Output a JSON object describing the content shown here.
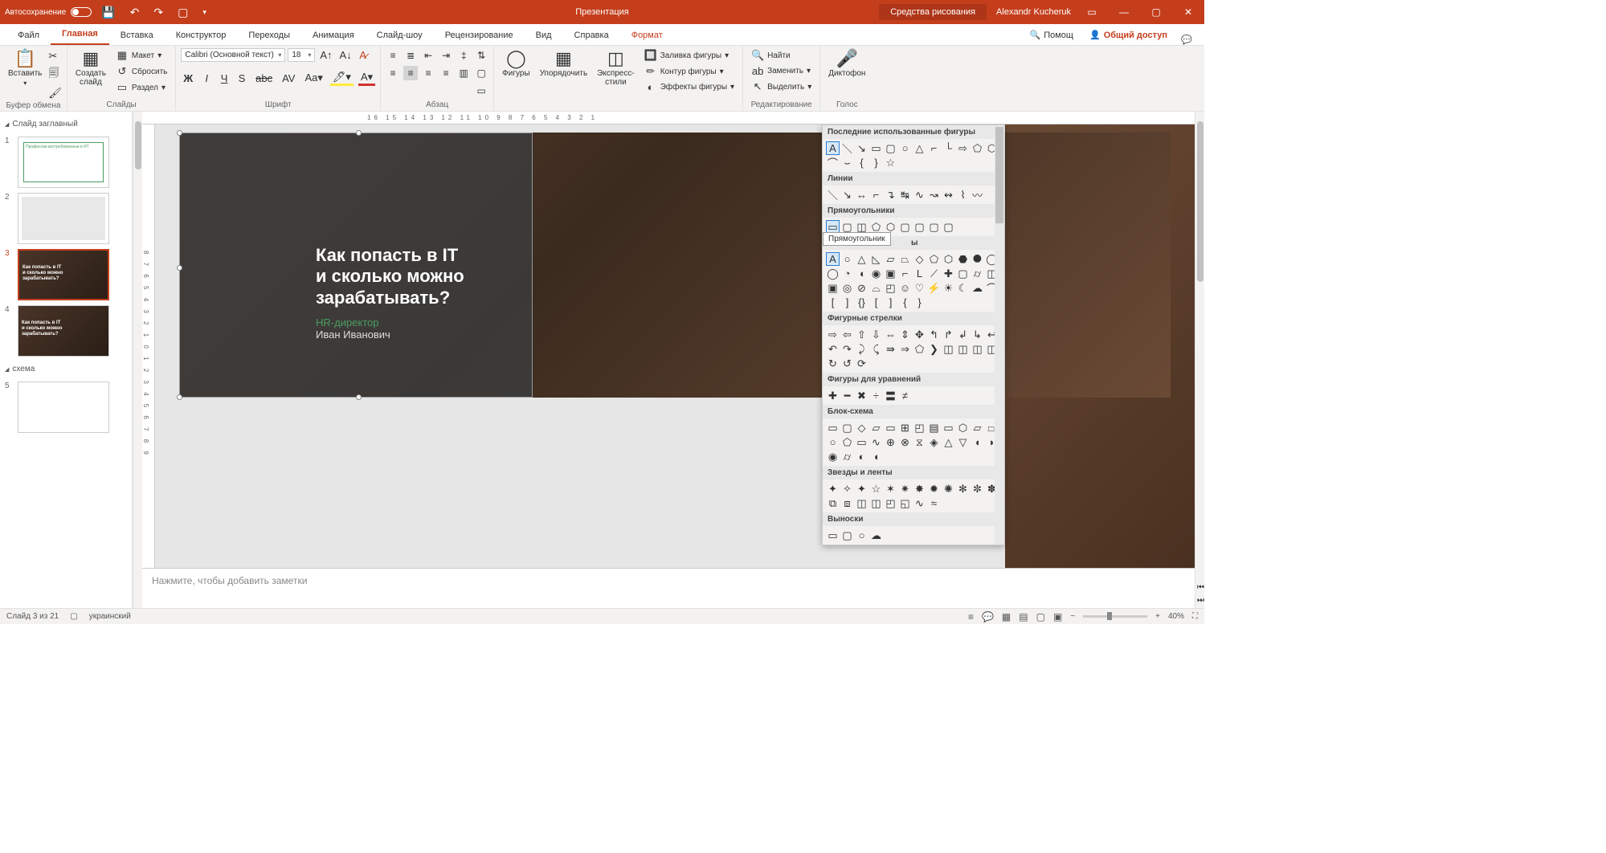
{
  "titlebar": {
    "autosave": "Автосохранение",
    "doc_title": "Презентация",
    "tools_context": "Средства рисования",
    "user": "Alexandr Kucheruk"
  },
  "tabs": {
    "file": "Файл",
    "home": "Главная",
    "insert": "Вставка",
    "design": "Конструктор",
    "transitions": "Переходы",
    "animations": "Анимация",
    "slideshow": "Слайд-шоу",
    "review": "Рецензирование",
    "view": "Вид",
    "help": "Справка",
    "format": "Формат",
    "tell_me": "Помощ",
    "share": "Общий доступ"
  },
  "ribbon": {
    "clipboard": {
      "paste": "Вставить",
      "label": "Буфер обмена"
    },
    "slides": {
      "new_slide": "Создать\nслайд",
      "layout": "Макет",
      "reset": "Сбросить",
      "section": "Раздел",
      "label": "Слайды"
    },
    "font": {
      "name": "Calibri (Основной текст)",
      "size": "18",
      "label": "Шрифт"
    },
    "paragraph": {
      "label": "Абзац"
    },
    "drawing": {
      "shapes": "Фигуры",
      "arrange": "Упорядочить",
      "styles": "Экспресс-\nстили",
      "fill": "Заливка фигуры",
      "outline": "Контур фигуры",
      "effects": "Эффекты фигуры"
    },
    "editing": {
      "find": "Найти",
      "replace": "Заменить",
      "select": "Выделить",
      "label": "Редактирование"
    },
    "voice": {
      "dictate": "Диктофон",
      "label": "Голос"
    }
  },
  "sections": {
    "title_section": "Слайд заглавный",
    "schema_section": "схема"
  },
  "slide_content": {
    "title": "Как попасть в IT\nи сколько можно\nзарабатывать?",
    "subtitle": "HR-директор",
    "name": "Иван Иванович",
    "thumb_text": "Как попасть в IT\nи сколько можно\nзарабатывать?"
  },
  "gallery": {
    "recent": "Последние использованные фигуры",
    "lines": "Линии",
    "rectangles": "Прямоугольники",
    "basic": "Основные фигуры",
    "arrows": "Фигурные стрелки",
    "equation": "Фигуры для уравнений",
    "flowchart": "Блок-схема",
    "stars": "Звезды и ленты",
    "callouts": "Выноски",
    "tooltip": "Прямоугольник"
  },
  "notes": {
    "placeholder": "Нажмите, чтобы добавить заметки"
  },
  "status": {
    "slide": "Слайд 3 из 21",
    "lang": "украинский",
    "zoom": "40%"
  },
  "ruler_h": "16 15 14 13 12 11 10 9  8  7  6  5  4  3  2  1",
  "ruler_v": "8 7 6 5 4 3 2 1 0 1 2 3 4 5 6 7 8 9"
}
